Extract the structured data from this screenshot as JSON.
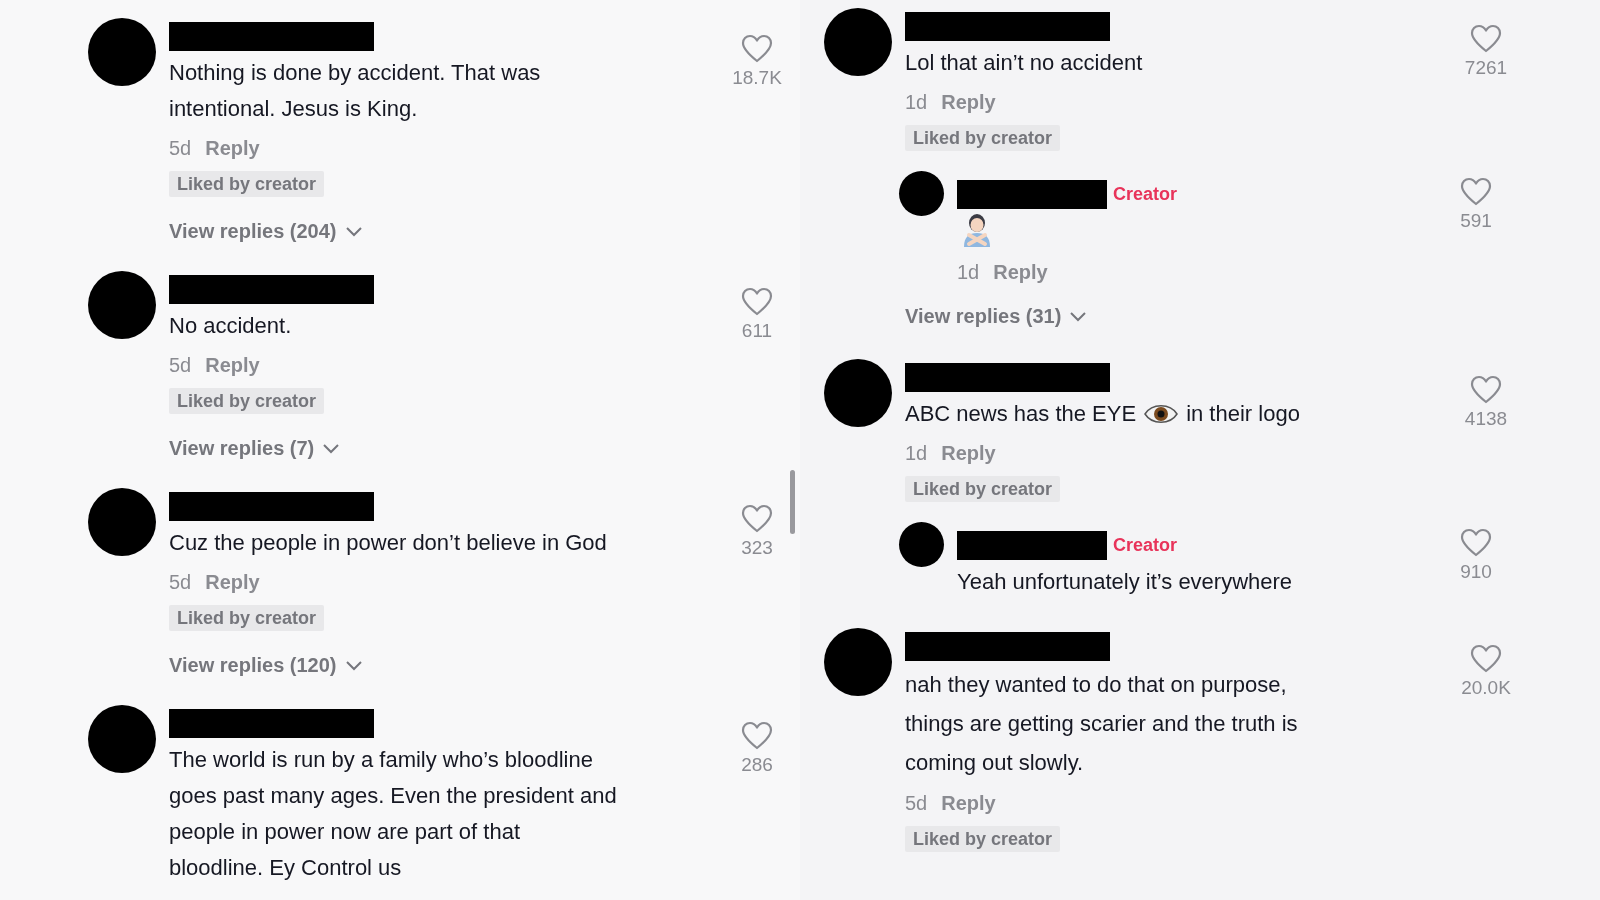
{
  "panels": [
    {
      "comments": [
        {
          "lines": [
            "Nothing is done by accident. That was",
            "intentional. Jesus is King."
          ],
          "time": "5d",
          "reply_label": "Reply",
          "liked_by_creator": true,
          "liked_label": "Liked by creator",
          "view_replies": "View replies (204)",
          "like_count": "18.7K"
        },
        {
          "lines": [
            "No accident."
          ],
          "time": "5d",
          "reply_label": "Reply",
          "liked_by_creator": true,
          "liked_label": "Liked by creator",
          "view_replies": "View replies (7)",
          "like_count": "611"
        },
        {
          "lines": [
            "Cuz the people in power don’t believe in God"
          ],
          "time": "5d",
          "reply_label": "Reply",
          "liked_by_creator": true,
          "liked_label": "Liked by creator",
          "view_replies": "View replies (120)",
          "like_count": "323"
        },
        {
          "lines": [
            "The world is run by a family who’s bloodline",
            "goes past many ages. Even the president and",
            "people in power now are part of that",
            "bloodline. Ey Control us"
          ],
          "like_count": "286"
        }
      ]
    },
    {
      "comments": [
        {
          "lines": [
            "Lol that ain’t no accident"
          ],
          "time": "1d",
          "reply_label": "Reply",
          "liked_by_creator": true,
          "liked_label": "Liked by creator",
          "like_count": "7261",
          "replies": [
            {
              "creator_label": "Creator",
              "kind": "emoji",
              "time": "1d",
              "reply_label": "Reply",
              "like_count": "591"
            }
          ],
          "view_replies": "View replies (31)"
        },
        {
          "text_before": "ABC news has the EYE",
          "text_after": "in their logo",
          "time": "1d",
          "reply_label": "Reply",
          "liked_by_creator": true,
          "liked_label": "Liked by creator",
          "like_count": "4138",
          "replies": [
            {
              "creator_label": "Creator",
              "kind": "text",
              "text": "Yeah unfortunately it’s everywhere",
              "like_count": "910"
            }
          ]
        },
        {
          "lines": [
            "nah they wanted to do that on purpose,",
            "things are getting scarier and the truth is",
            "coming out slowly."
          ],
          "time": "5d",
          "reply_label": "Reply",
          "liked_by_creator": true,
          "liked_label": "Liked by creator",
          "like_count": "20.0K"
        }
      ]
    }
  ]
}
